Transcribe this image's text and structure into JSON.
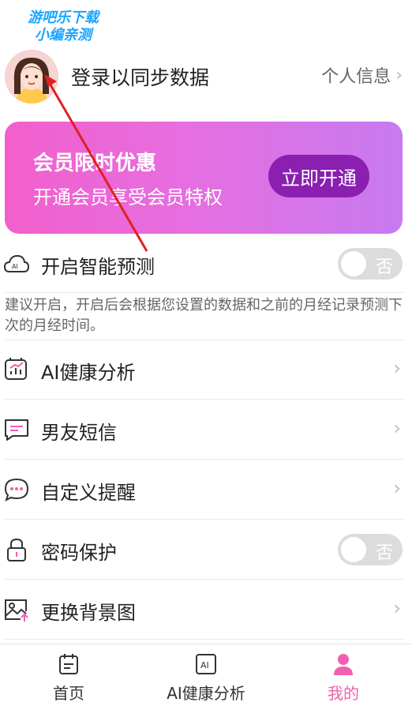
{
  "watermark": {
    "line1": "游吧乐下载",
    "line2": "小编亲测"
  },
  "profile": {
    "login_text": "登录以同步数据",
    "personal_info_label": "个人信息"
  },
  "vip": {
    "title": "会员限时优惠",
    "subtitle": "开通会员享受会员特权",
    "button_label": "立即开通"
  },
  "settings": {
    "smart_prediction": {
      "label": "开启智能预测",
      "toggle_text": "否",
      "enabled": false,
      "hint": "建议开启，开启后会根据您设置的数据和之前的月经记录预测下次的月经时间。"
    },
    "items": [
      {
        "label": "AI健康分析"
      },
      {
        "label": "男友短信"
      },
      {
        "label": "自定义提醒"
      }
    ],
    "password": {
      "label": "密码保护",
      "toggle_text": "否",
      "enabled": false
    },
    "background": {
      "label": "更换背景图"
    }
  },
  "tabs": [
    {
      "label": "首页",
      "active": false
    },
    {
      "label": "AI健康分析",
      "active": false
    },
    {
      "label": "我的",
      "active": true
    }
  ],
  "colors": {
    "accent": "#f25fb0",
    "vip_button": "#8a1fb0",
    "arrow": "#e02020"
  }
}
